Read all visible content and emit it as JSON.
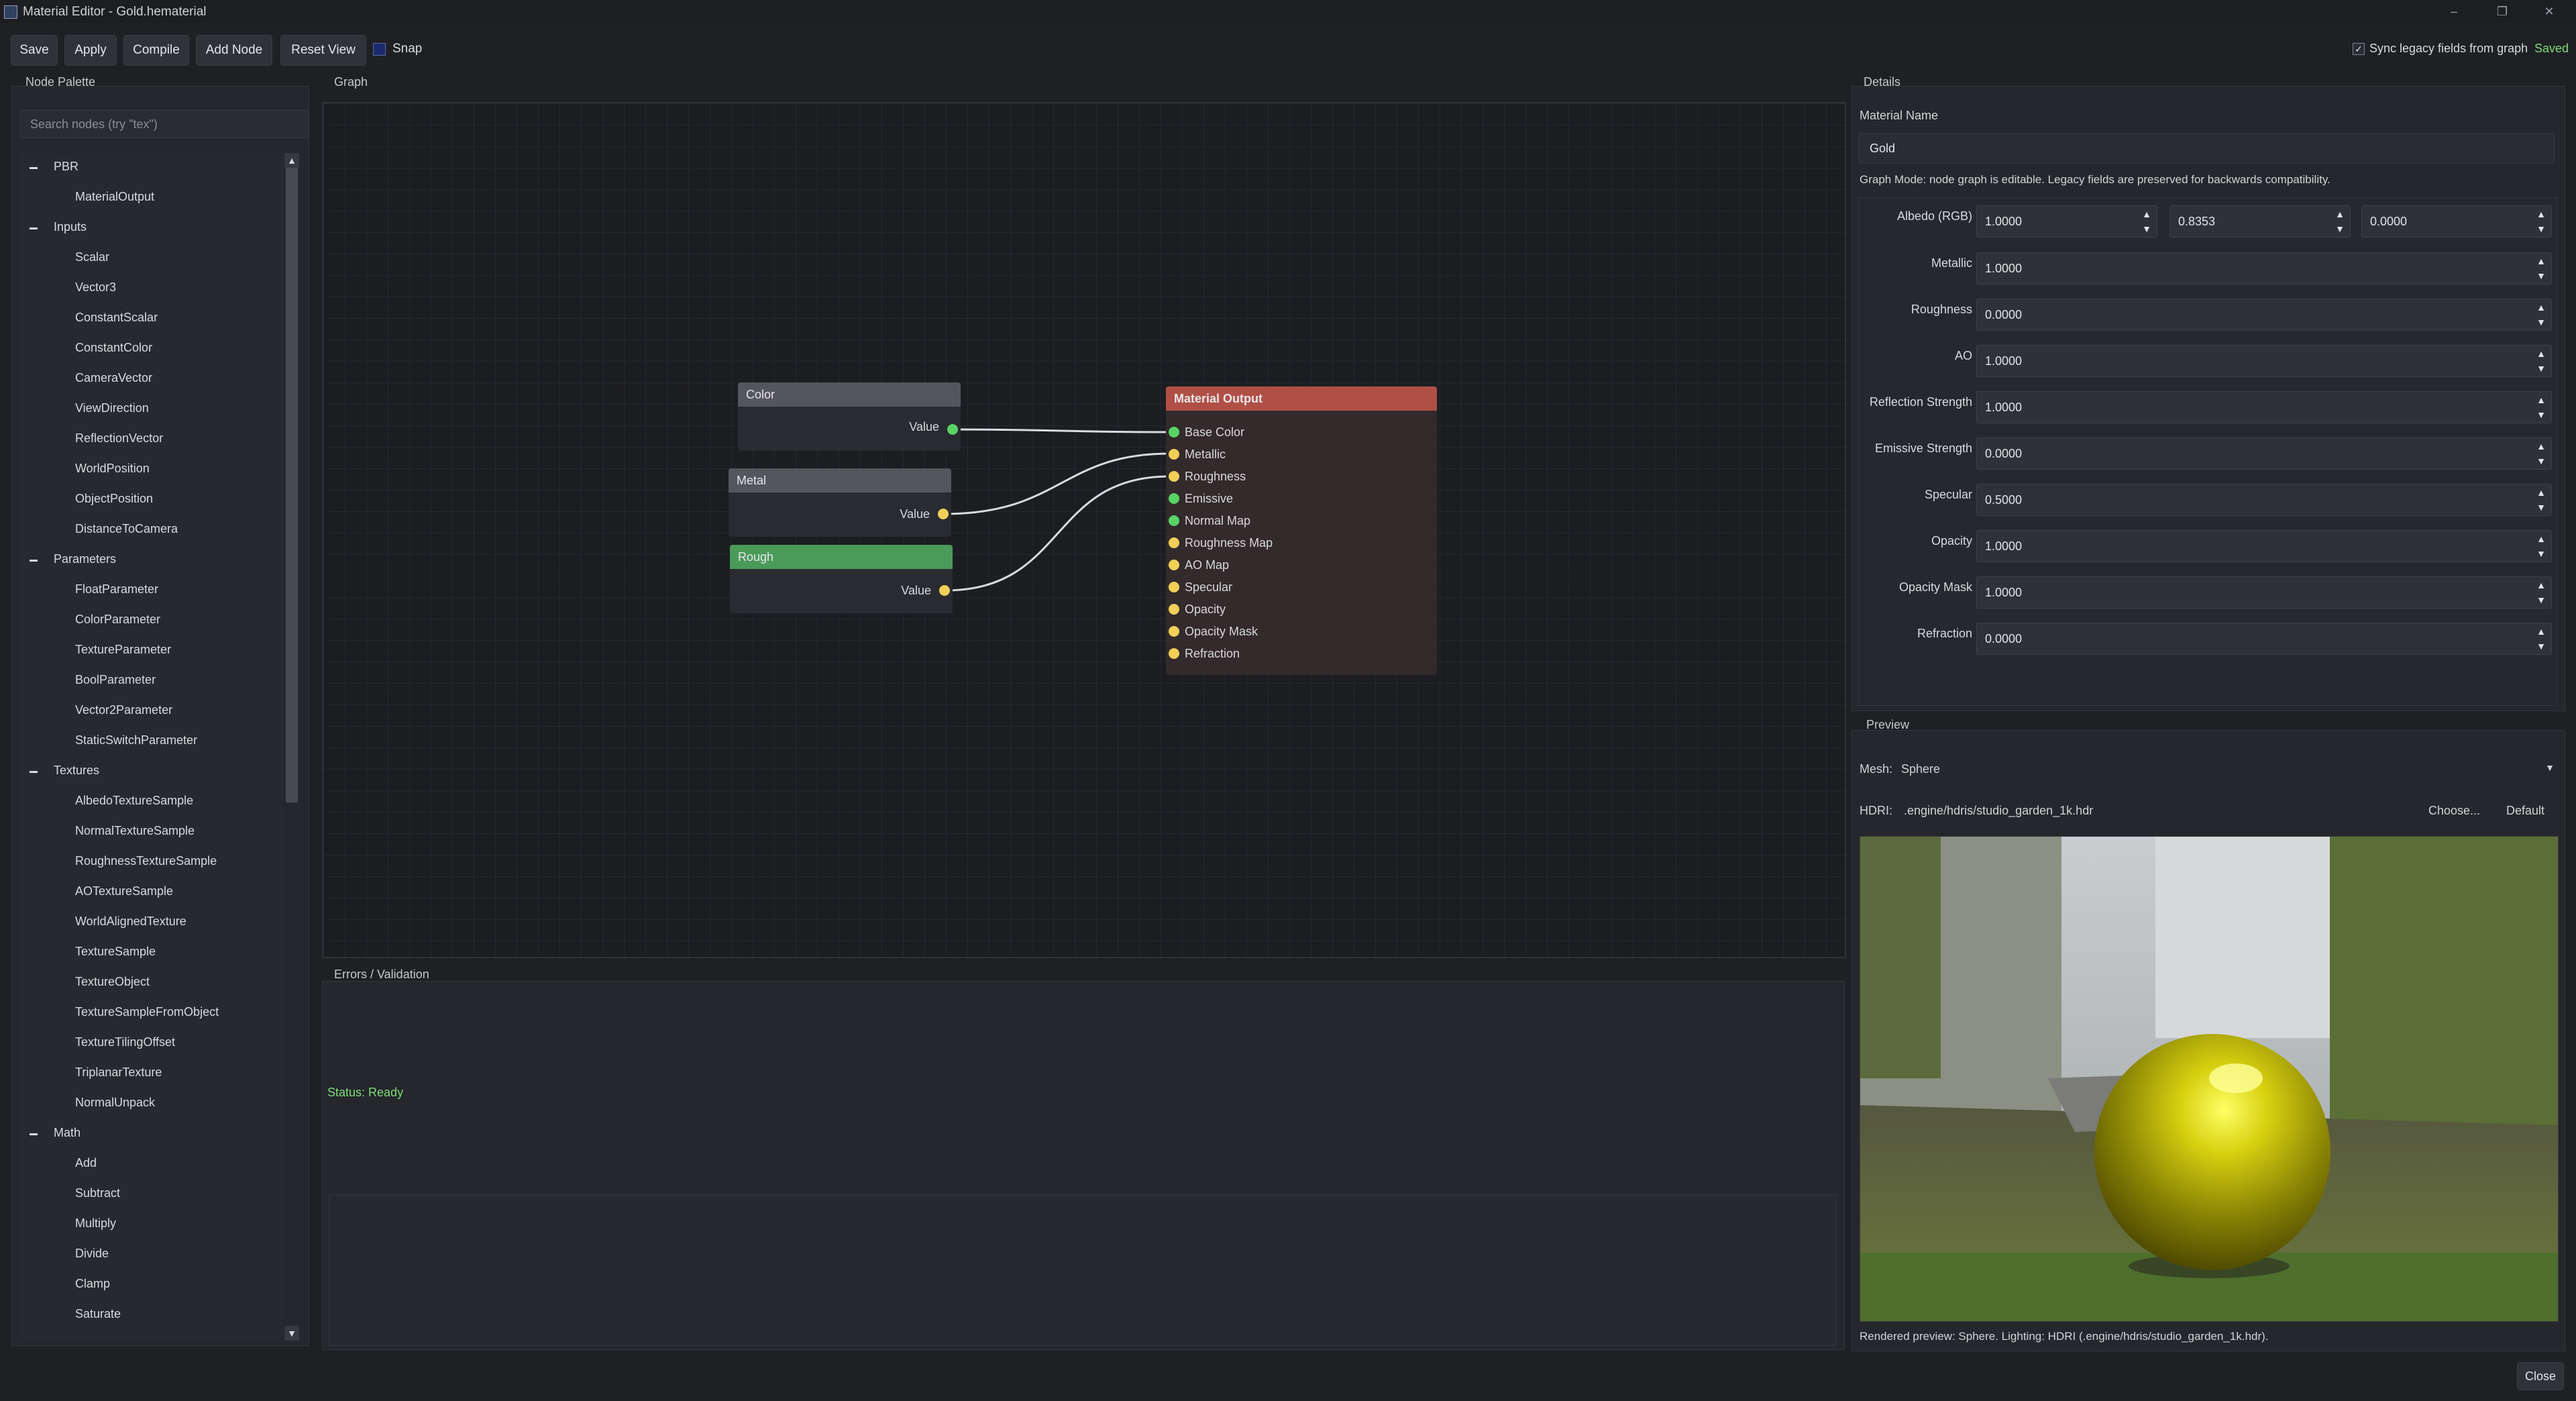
{
  "window": {
    "title": "Material Editor - Gold.hematerial"
  },
  "toolbar": {
    "save": "Save",
    "apply": "Apply",
    "compile": "Compile",
    "add_node": "Add Node",
    "reset_view": "Reset View",
    "snap": "Snap",
    "sync": "Sync legacy fields from graph",
    "saved": "Saved",
    "snap_checked": true,
    "sync_checked": true
  },
  "palette": {
    "title": "Node Palette",
    "search_placeholder": "Search nodes (try \"tex\")",
    "groups": [
      {
        "name": "PBR",
        "items": [
          "MaterialOutput"
        ]
      },
      {
        "name": "Inputs",
        "items": [
          "Scalar",
          "Vector3",
          "ConstantScalar",
          "ConstantColor",
          "CameraVector",
          "ViewDirection",
          "ReflectionVector",
          "WorldPosition",
          "ObjectPosition",
          "DistanceToCamera"
        ]
      },
      {
        "name": "Parameters",
        "items": [
          "FloatParameter",
          "ColorParameter",
          "TextureParameter",
          "BoolParameter",
          "Vector2Parameter",
          "StaticSwitchParameter"
        ]
      },
      {
        "name": "Textures",
        "items": [
          "AlbedoTextureSample",
          "NormalTextureSample",
          "RoughnessTextureSample",
          "AOTextureSample",
          "WorldAlignedTexture",
          "TextureSample",
          "TextureObject",
          "TextureSampleFromObject",
          "TextureTilingOffset",
          "TriplanarTexture",
          "NormalUnpack"
        ]
      },
      {
        "name": "Math",
        "items": [
          "Add",
          "Subtract",
          "Multiply",
          "Divide",
          "Clamp",
          "Saturate"
        ]
      }
    ]
  },
  "graph": {
    "title": "Graph",
    "nodes": {
      "color": {
        "title": "Color",
        "output": "Value"
      },
      "metal": {
        "title": "Metal",
        "output": "Value"
      },
      "rough": {
        "title": "Rough",
        "output": "Value"
      },
      "output": {
        "title": "Material Output",
        "inputs": [
          "Base Color",
          "Metallic",
          "Roughness",
          "Emissive",
          "Normal Map",
          "Roughness Map",
          "AO Map",
          "Specular",
          "Opacity",
          "Opacity Mask",
          "Refraction"
        ]
      }
    }
  },
  "errors": {
    "title": "Errors / Validation",
    "status": "Status: Ready"
  },
  "details": {
    "title": "Details",
    "material_name_label": "Material Name",
    "material_name": "Gold",
    "mode_text": "Graph Mode: node graph is editable. Legacy fields are preserved for backwards compatibility.",
    "albedo": {
      "label": "Albedo (RGB)",
      "r": "1.0000",
      "g": "0.8353",
      "b": "0.0000"
    },
    "fields": [
      {
        "label": "Metallic",
        "value": "1.0000"
      },
      {
        "label": "Roughness",
        "value": "0.0000"
      },
      {
        "label": "AO",
        "value": "1.0000"
      },
      {
        "label": "Reflection Strength",
        "value": "1.0000"
      },
      {
        "label": "Emissive Strength",
        "value": "0.0000"
      },
      {
        "label": "Specular",
        "value": "0.5000"
      },
      {
        "label": "Opacity",
        "value": "1.0000"
      },
      {
        "label": "Opacity Mask",
        "value": "1.0000"
      },
      {
        "label": "Refraction",
        "value": "0.0000"
      }
    ]
  },
  "preview": {
    "title": "Preview",
    "mesh_label": "Mesh:",
    "mesh_value": "Sphere",
    "hdri_label": "HDRI:",
    "hdri_value": ".engine/hdris/studio_garden_1k.hdr",
    "choose": "Choose...",
    "default": "Default",
    "caption": "Rendered preview: Sphere. Lighting: HDRI (.engine/hdris/studio_garden_1k.hdr)."
  },
  "footer": {
    "close": "Close"
  }
}
